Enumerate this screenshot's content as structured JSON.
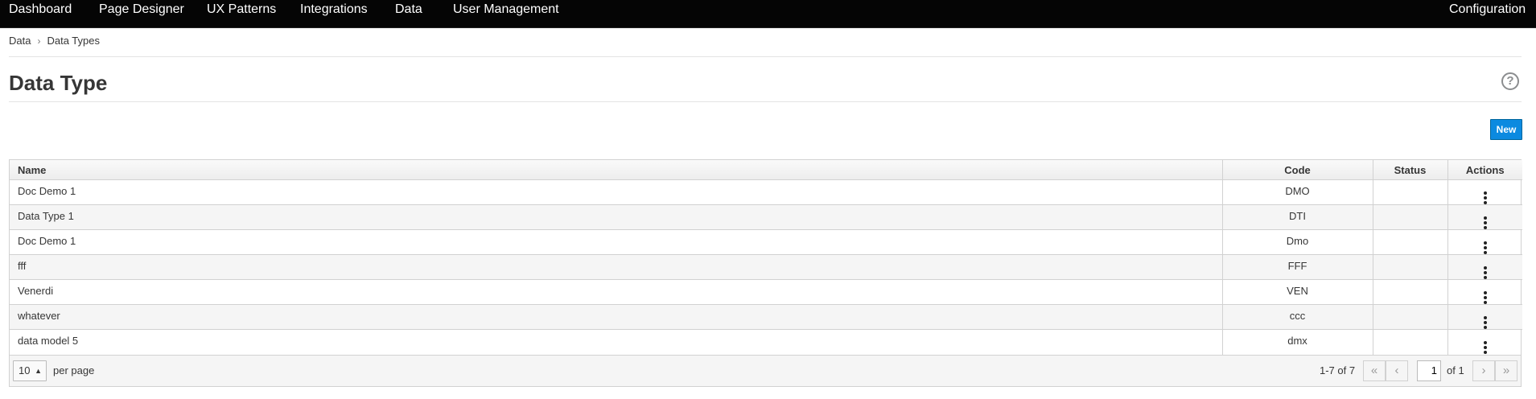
{
  "nav": {
    "items": [
      "Dashboard",
      "Page Designer",
      "UX Patterns",
      "Integrations",
      "Data",
      "User Management"
    ],
    "right": "Configuration"
  },
  "breadcrumb": {
    "parent": "Data",
    "separator": "›",
    "current": "Data Types"
  },
  "page": {
    "title": "Data Type",
    "help_icon": "?",
    "new_button": "New"
  },
  "table": {
    "columns": [
      "Name",
      "Code",
      "Status",
      "Actions"
    ],
    "rows": [
      {
        "name": "Doc Demo 1",
        "code": "DMO",
        "status": ""
      },
      {
        "name": "Data Type 1",
        "code": "DTI",
        "status": ""
      },
      {
        "name": "Doc Demo 1",
        "code": "Dmo",
        "status": ""
      },
      {
        "name": "fff",
        "code": "FFF",
        "status": ""
      },
      {
        "name": "Venerdi",
        "code": "VEN",
        "status": ""
      },
      {
        "name": "whatever",
        "code": "ccc",
        "status": ""
      },
      {
        "name": "data model 5",
        "code": "dmx",
        "status": ""
      }
    ]
  },
  "pagination": {
    "per_page_value": "10",
    "per_page_label": "per page",
    "range": "1-7 of 7",
    "current_page": "1",
    "of_pages": "of 1",
    "first": "«",
    "prev": "‹",
    "next": "›",
    "last": "»"
  },
  "colors": {
    "nav_bg": "#050505",
    "primary": "#0b8ae0",
    "row_alt": "#f5f5f5"
  }
}
